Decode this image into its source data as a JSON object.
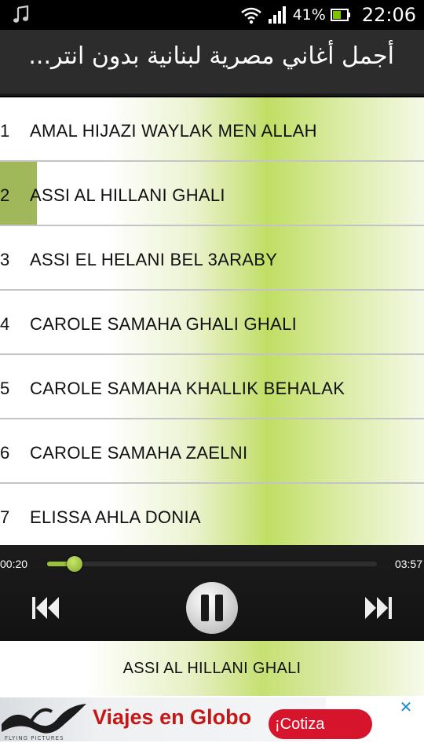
{
  "status_bar": {
    "battery_percent": "41%",
    "time": "22:06",
    "icons": [
      "music-note-icon",
      "wifi-icon",
      "signal-icon",
      "battery-icon"
    ]
  },
  "app": {
    "title": "أجمل أغاني مصرية لبنانية بدون انتر..."
  },
  "songs": [
    {
      "num": "1",
      "title": "AMAL HIJAZI WAYLAK MEN ALLAH"
    },
    {
      "num": "2",
      "title": "ASSI AL HILLANI GHALI",
      "selected": true
    },
    {
      "num": "3",
      "title": "ASSI EL HELANI BEL 3ARABY"
    },
    {
      "num": "4",
      "title": "CAROLE SAMAHA GHALI GHALI"
    },
    {
      "num": "5",
      "title": "CAROLE SAMAHA KHALLIK BEHALAK"
    },
    {
      "num": "6",
      "title": "CAROLE SAMAHA ZAELNI"
    },
    {
      "num": "7",
      "title": "ELISSA AHLA DONIA"
    }
  ],
  "player": {
    "current_time": "00:20",
    "total_time": "03:57",
    "progress": 0.084,
    "state": "playing",
    "accent_color": "#9bc13a"
  },
  "now_playing": {
    "title": "ASSI AL HILLANI GHALI"
  },
  "ad": {
    "brand": "FLYING PICTURES",
    "headline": "Viajes en Globo",
    "cta": "¡Cotiza",
    "close_icon": "close-icon"
  }
}
